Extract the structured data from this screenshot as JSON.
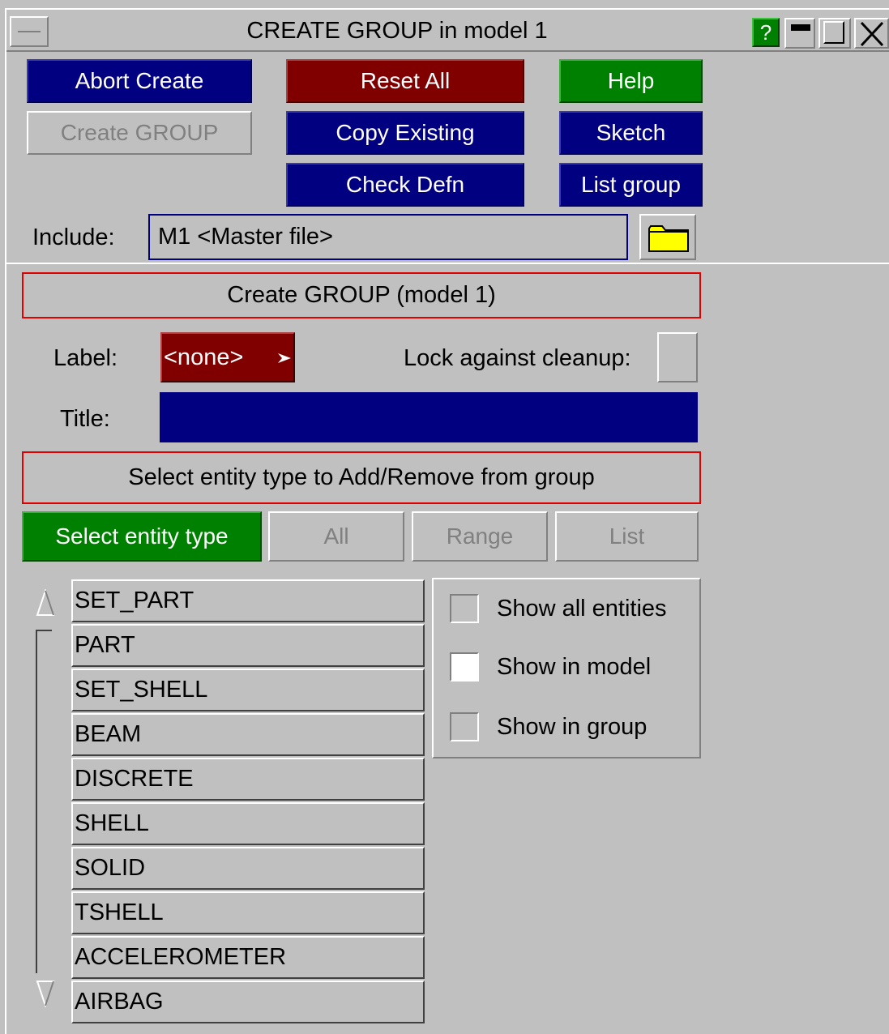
{
  "window": {
    "title": "CREATE GROUP in model 1",
    "help_icon_label": "?"
  },
  "actions": {
    "abort_create": "Abort Create",
    "reset_all": "Reset All",
    "help": "Help",
    "create_group": "Create GROUP",
    "copy_existing": "Copy Existing",
    "sketch": "Sketch",
    "check_defn": "Check Defn",
    "list_group": "List group"
  },
  "include": {
    "label": "Include:",
    "value": "M1  <Master file>",
    "folder_icon": "folder-icon"
  },
  "create_section": {
    "header": "Create GROUP (model 1)",
    "label_caption": "Label:",
    "label_value": "<none>",
    "lock_caption": "Lock against cleanup:",
    "title_caption": "Title:",
    "title_value": ""
  },
  "entity_section": {
    "header": "Select entity type to Add/Remove from group",
    "tabs": {
      "select_entity_type": "Select entity type",
      "all": "All",
      "range": "Range",
      "list": "List"
    },
    "entity_types": [
      "SET_PART",
      "PART",
      "SET_SHELL",
      "BEAM",
      "DISCRETE",
      "SHELL",
      "SOLID",
      "TSHELL",
      "ACCELEROMETER",
      "AIRBAG"
    ],
    "options": [
      {
        "label": "Show all entities",
        "checked": false
      },
      {
        "label": "Show in model",
        "checked": true
      },
      {
        "label": "Show in group",
        "checked": false
      }
    ]
  },
  "colors": {
    "panel_bg": "#c0c0c0",
    "blue_button": "#000080",
    "red_button": "#800000",
    "green_button": "#008000",
    "highlight_border": "#e00000",
    "folder_yellow": "#ffff00"
  }
}
